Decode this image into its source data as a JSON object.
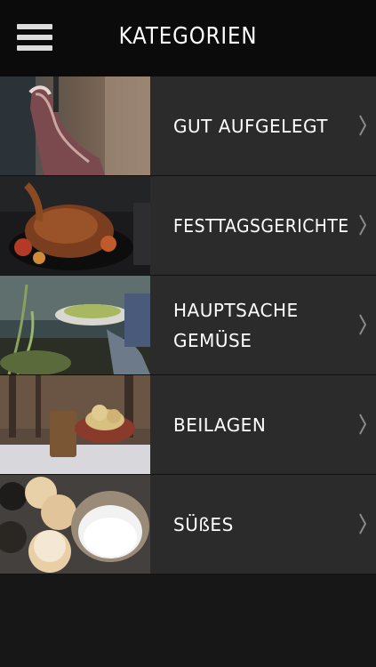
{
  "header": {
    "title": "KATEGORIEN",
    "menu_icon": "hamburger-menu-icon"
  },
  "categories": [
    {
      "label": "GUT AUFGELEGT",
      "image": "roast-leg-photo",
      "chevron": "chevron-right-icon"
    },
    {
      "label": "FESTTAGSGERICHTE",
      "image": "roast-goose-photo",
      "chevron": "chevron-right-icon"
    },
    {
      "label": "HAUPTSACHE\nGEMÜSE",
      "image": "vegetable-dish-photo",
      "chevron": "chevron-right-icon"
    },
    {
      "label": "BEILAGEN",
      "image": "side-dish-photo",
      "chevron": "chevron-right-icon"
    },
    {
      "label": "SÜßES",
      "image": "sweet-buns-photo",
      "chevron": "chevron-right-icon"
    }
  ],
  "colors": {
    "header_bg": "#0b0b0b",
    "row_bg": "#2b2b2b",
    "page_bg": "#171717",
    "text": "#ffffff",
    "chevron": "#8a8a8a"
  }
}
